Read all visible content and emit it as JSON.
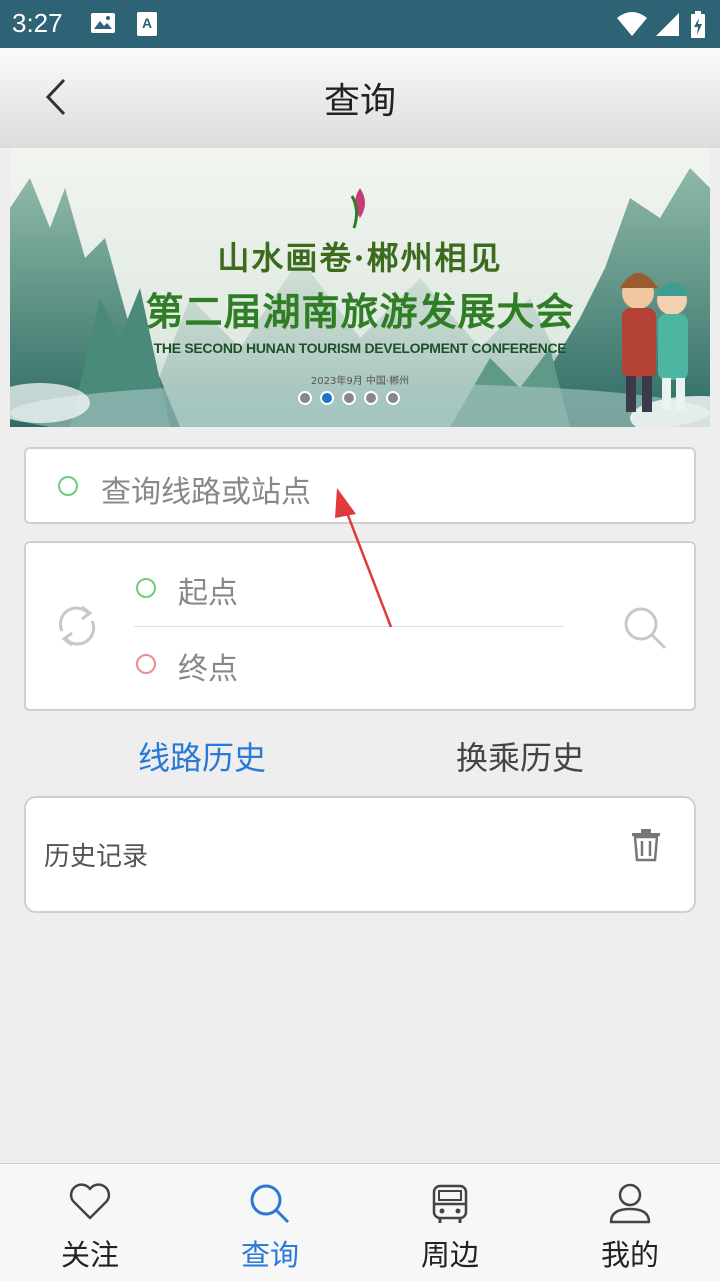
{
  "status": {
    "time": "3:27"
  },
  "header": {
    "title": "查询"
  },
  "banner": {
    "slogan": "山水画卷·郴州相见",
    "headline": "第二届湖南旅游发展大会",
    "subline": "THE SECOND HUNAN TOURISM DEVELOPMENT CONFERENCE",
    "dateline": "2023年9月 中国·郴州",
    "page_count": 5,
    "active_page": 2
  },
  "search": {
    "placeholder": "查询线路或站点"
  },
  "route": {
    "start_placeholder": "起点",
    "end_placeholder": "终点"
  },
  "tabs": [
    {
      "label": "线路历史",
      "active": true
    },
    {
      "label": "换乘历史",
      "active": false
    }
  ],
  "history": {
    "label": "历史记录"
  },
  "nav": [
    {
      "label": "关注",
      "icon": "heart-icon",
      "active": false
    },
    {
      "label": "查询",
      "icon": "search-icon",
      "active": true
    },
    {
      "label": "周边",
      "icon": "bus-icon",
      "active": false
    },
    {
      "label": "我的",
      "icon": "user-icon",
      "active": false
    }
  ],
  "colors": {
    "statusbar": "#2e6275",
    "accent": "#2979d6",
    "start_dot": "#6cce7a",
    "end_dot": "#ee8b8b",
    "annotation_arrow": "#e03a3a"
  }
}
